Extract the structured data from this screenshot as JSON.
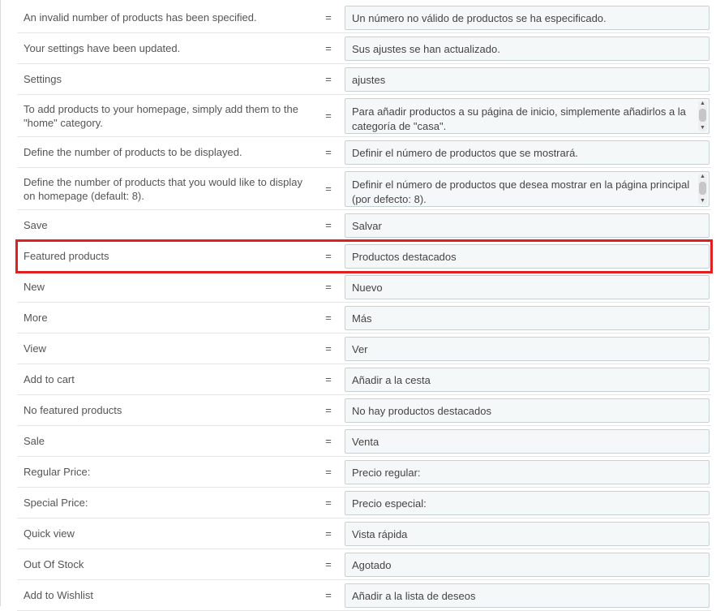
{
  "translations": [
    {
      "source": "An invalid number of products has been specified.",
      "target": "Un número no válido de productos se ha especificado.",
      "multiline": false
    },
    {
      "source": "Your settings have been updated.",
      "target": "Sus ajustes se han actualizado.",
      "multiline": false
    },
    {
      "source": "Settings",
      "target": "ajustes",
      "multiline": false
    },
    {
      "source": "To add products to your homepage, simply add them to the \"home\" category.",
      "target": "Para añadir productos a su página de inicio, simplemente añadirlos a la categoría de \"casa\".",
      "multiline": true
    },
    {
      "source": "Define the number of products to be displayed.",
      "target": "Definir el número de productos que se mostrará.",
      "multiline": false
    },
    {
      "source": "Define the number of products that you would like to display on homepage (default: 8).",
      "target": "Definir el número de productos que desea mostrar en la página principal (por defecto: 8).",
      "multiline": true
    },
    {
      "source": "Save",
      "target": "Salvar",
      "multiline": false
    },
    {
      "source": "Featured products",
      "target": "Productos destacados",
      "multiline": false,
      "highlighted": true
    },
    {
      "source": "New",
      "target": "Nuevo",
      "multiline": false
    },
    {
      "source": "More",
      "target": "Más",
      "multiline": false
    },
    {
      "source": "View",
      "target": "Ver",
      "multiline": false
    },
    {
      "source": "Add to cart",
      "target": "Añadir a la cesta",
      "multiline": false
    },
    {
      "source": "No featured products",
      "target": "No hay productos destacados",
      "multiline": false
    },
    {
      "source": "Sale",
      "target": "Venta",
      "multiline": false
    },
    {
      "source": "Regular Price:",
      "target": "Precio regular:",
      "multiline": false
    },
    {
      "source": "Special Price:",
      "target": "Precio especial:",
      "multiline": false
    },
    {
      "source": "Quick view",
      "target": "Vista rápida",
      "multiline": false
    },
    {
      "source": "Out Of Stock",
      "target": "Agotado",
      "multiline": false
    },
    {
      "source": "Add to Wishlist",
      "target": "Añadir a la lista de deseos",
      "multiline": false
    }
  ],
  "separator": "=",
  "colors": {
    "highlight": "#e02020",
    "field_bg": "#f5f8f9",
    "field_border": "#c7d0d3"
  }
}
